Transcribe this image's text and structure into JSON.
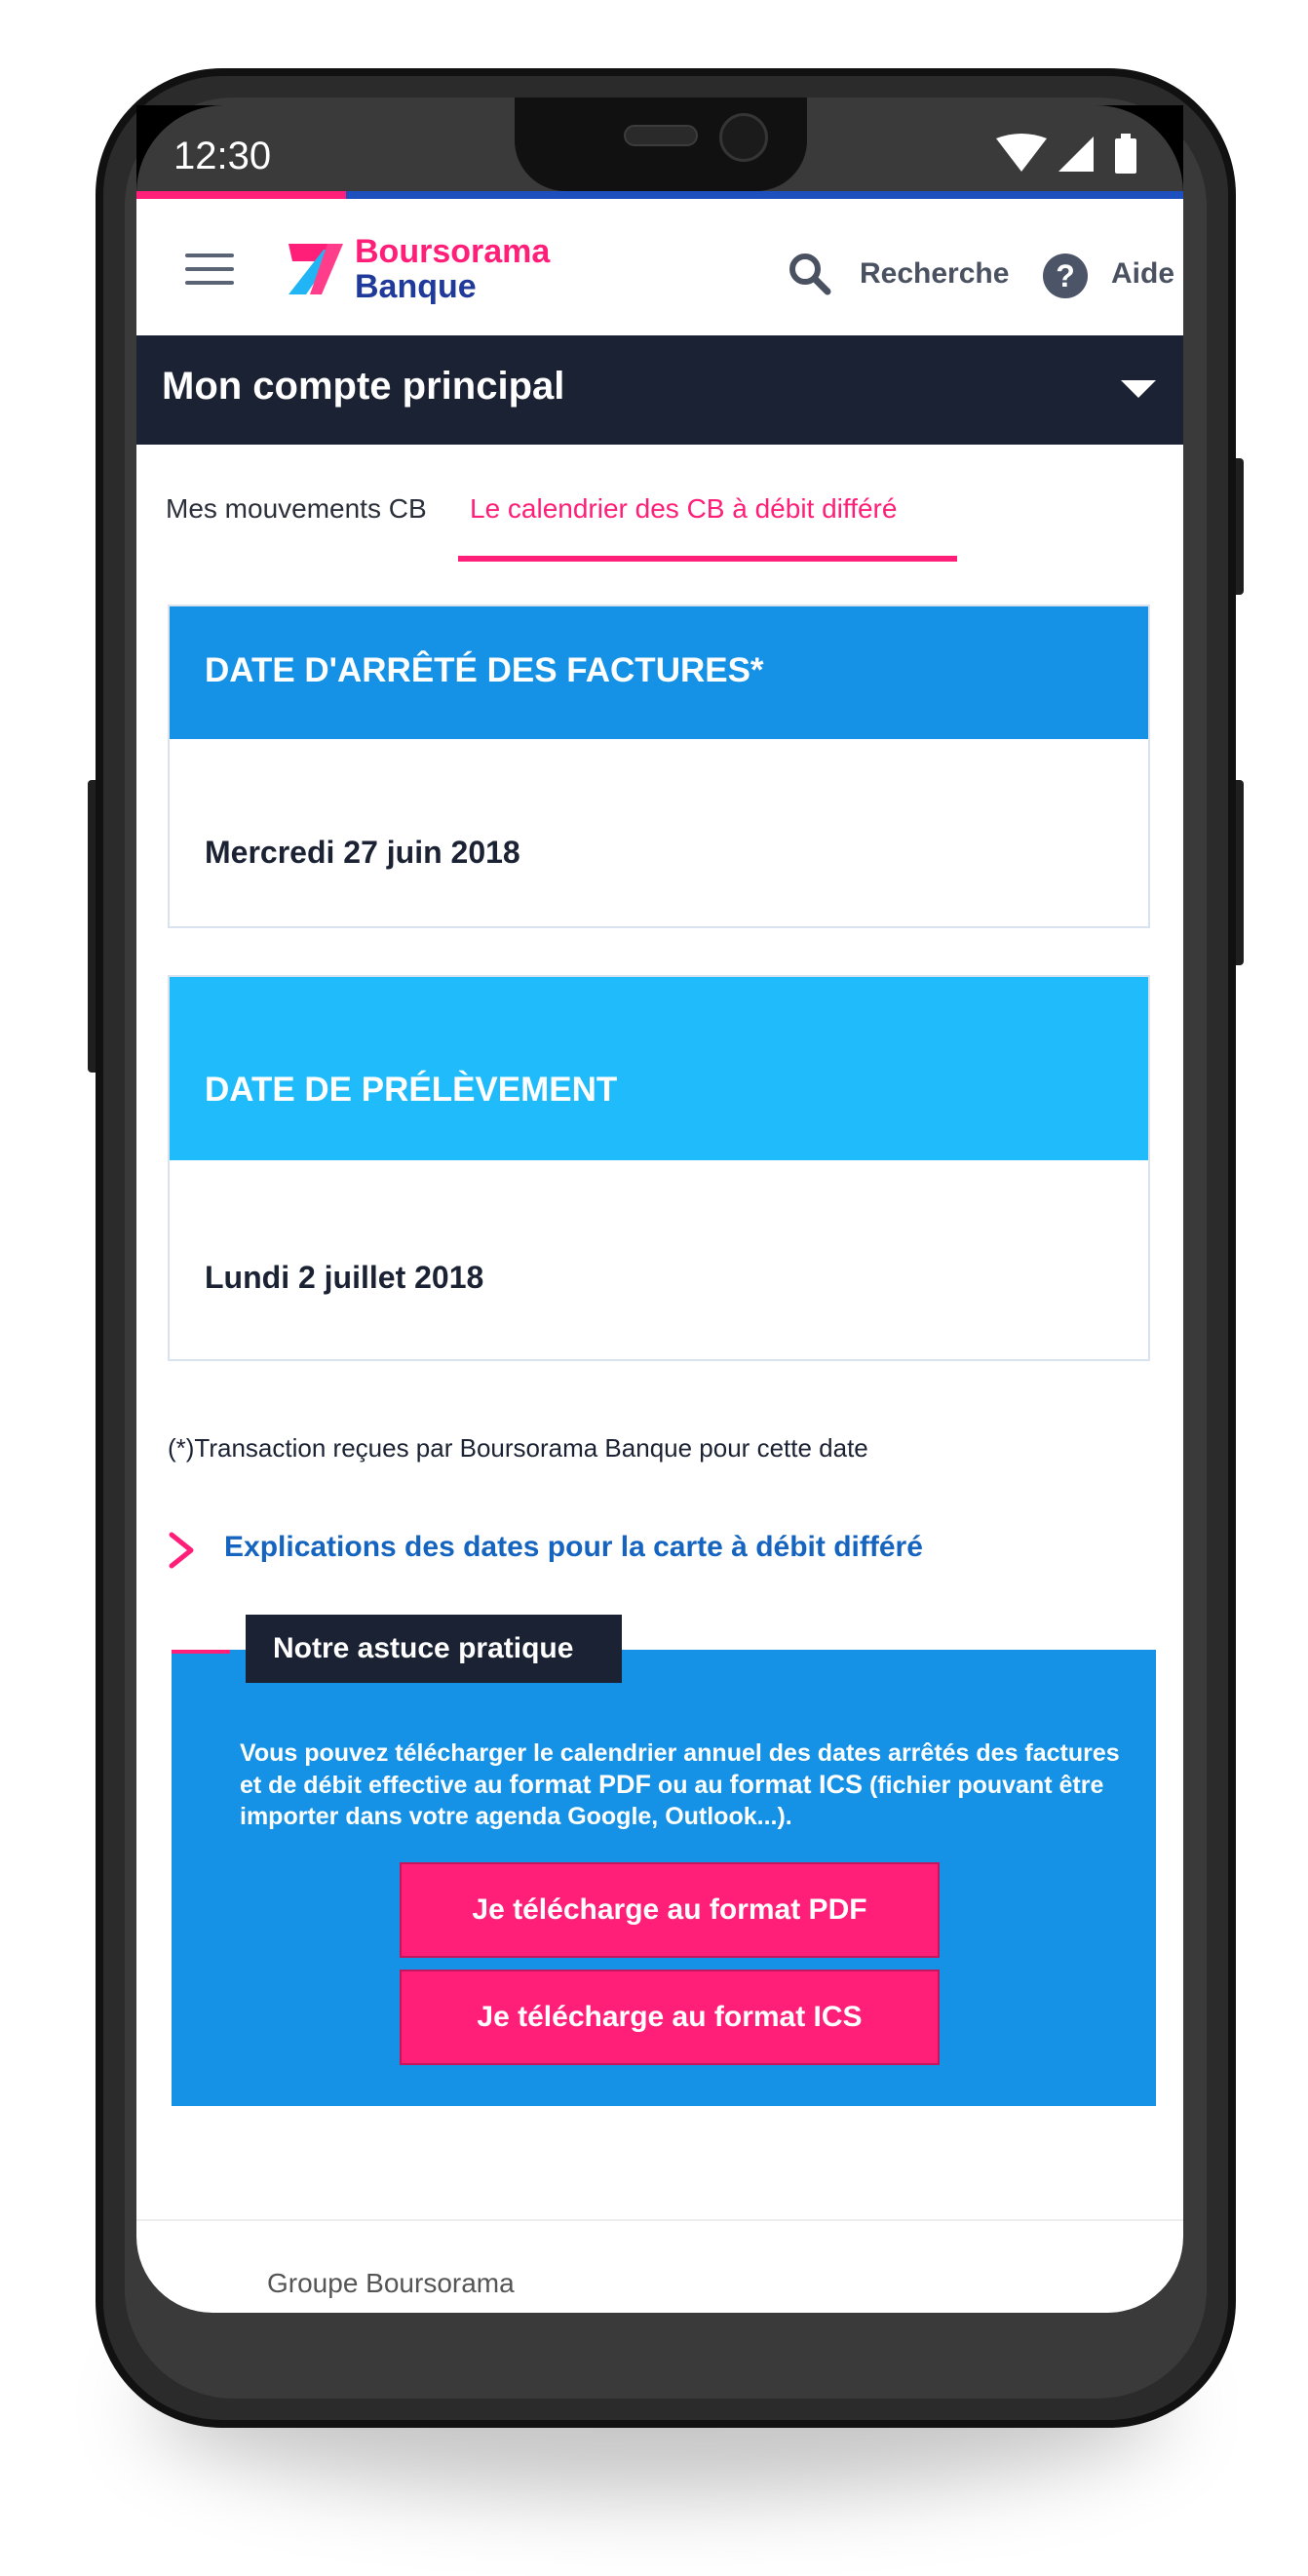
{
  "status_bar": {
    "time": "12:30"
  },
  "header": {
    "brand_line1": "Boursorama",
    "brand_line2": "Banque",
    "search_label": "Recherche",
    "help_label": "Aide"
  },
  "account": {
    "title": "Mon compte principal"
  },
  "tabs": [
    {
      "label": "Mes mouvements CB",
      "active": false
    },
    {
      "label": "Le calendrier des CB à débit différé",
      "active": true
    }
  ],
  "cards": [
    {
      "heading": "DATE D'ARRÊTÉ DES FACTURES*",
      "value": "Mercredi 27 juin 2018"
    },
    {
      "heading": "DATE DE PRÉLÈVEMENT",
      "value": "Lundi 2 juillet 2018"
    }
  ],
  "footnote": "(*)Transaction reçues par Boursorama Banque pour cette date",
  "explain_link": "Explications des dates pour la carte à débit différé",
  "tip": {
    "label": "Notre astuce pratique",
    "text_part1": "Vous pouvez télécharger le calendrier annuel des dates arrêtés des factures et de débit effective au ",
    "format_pdf": "format PDF",
    "text_part2": " ou au ",
    "format_ics": "format ICS",
    "text_part3": " (fichier pouvant être importer dans votre agenda Google, Outlook...).",
    "button_pdf": "Je télécharge au format PDF",
    "button_ics": "Je télécharge au format ICS"
  },
  "footer": {
    "text": "Groupe Boursorama"
  },
  "colors": {
    "brand_pink": "#ff1e78",
    "brand_navy": "#1b2233",
    "card_blue": "#1592e6",
    "card_cyan": "#20bbfa",
    "link_blue": "#1565c0"
  }
}
